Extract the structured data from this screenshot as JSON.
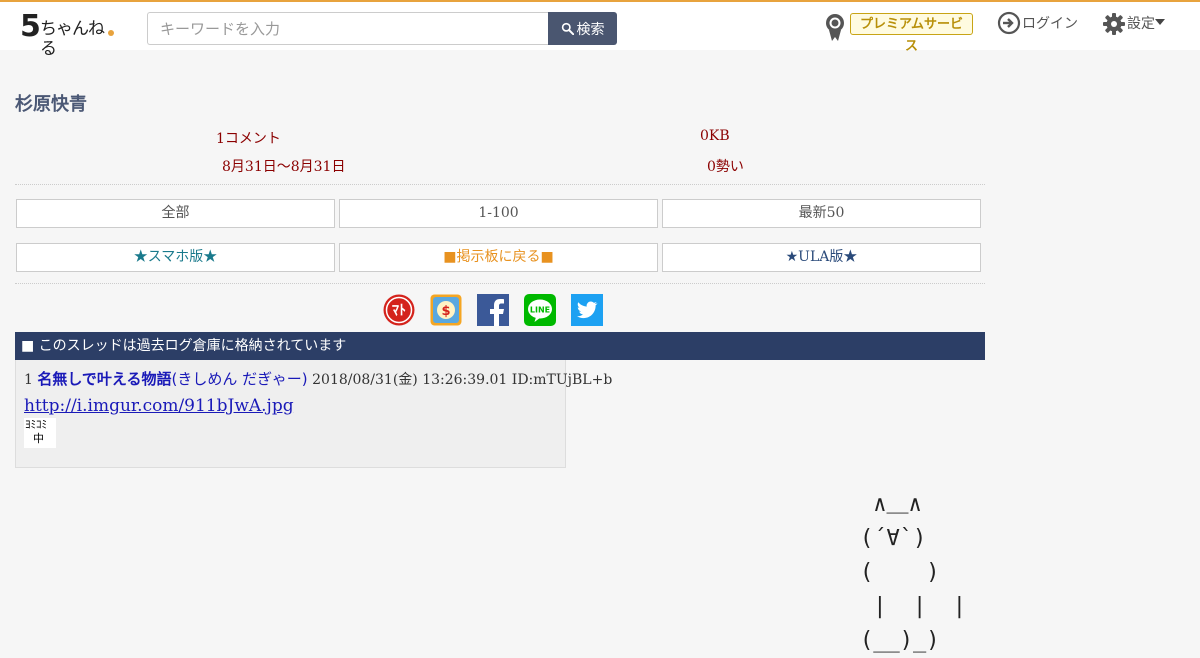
{
  "header": {
    "logo_digit": "5",
    "logo_text": "ちゃんねる",
    "search_placeholder": "キーワードを入力",
    "search_button": "検索",
    "premium_label": "プレミアムサービス",
    "login_label": "ログイン",
    "settings_label": "設定"
  },
  "thread": {
    "title": "杉原快青",
    "comments": "1コメント",
    "size": "0KB",
    "date_range": "8月31日〜8月31日",
    "momentum": "0勢い"
  },
  "nav_buttons": {
    "all": "全部",
    "range": "1-100",
    "latest": "最新50",
    "smartphone": "★スマホ版★",
    "back_to_board": "■掲示板に戻る■",
    "ula": "★ULA版★"
  },
  "share_icons": [
    "matome-icon",
    "dollar-icon",
    "facebook-icon",
    "line-icon",
    "twitter-icon"
  ],
  "archived_notice": "■ このスレッドは過去ログ倉庫に格納されています",
  "post": {
    "number": "1",
    "name": "名無しで叶える物語",
    "trip": "(きしめん だぎゃー)",
    "datetime": "2018/08/31(金) 13:26:39.01",
    "id": "ID:mTUjBL+b",
    "link": "http://i.imgur.com/911bJwA.jpg",
    "thumb_line1": "ﾖﾐｺﾐ",
    "thumb_line2": "中"
  },
  "ascii_cat": " ∧＿∧\n(´∀`)\n(    )\n |  |  |\n(__)_)",
  "colors": {
    "accent": "#e8a33d",
    "nav_bar": "#2c3e66",
    "title": "#4b5875",
    "meta": "#8b0000",
    "link": "#1a1ab8"
  }
}
